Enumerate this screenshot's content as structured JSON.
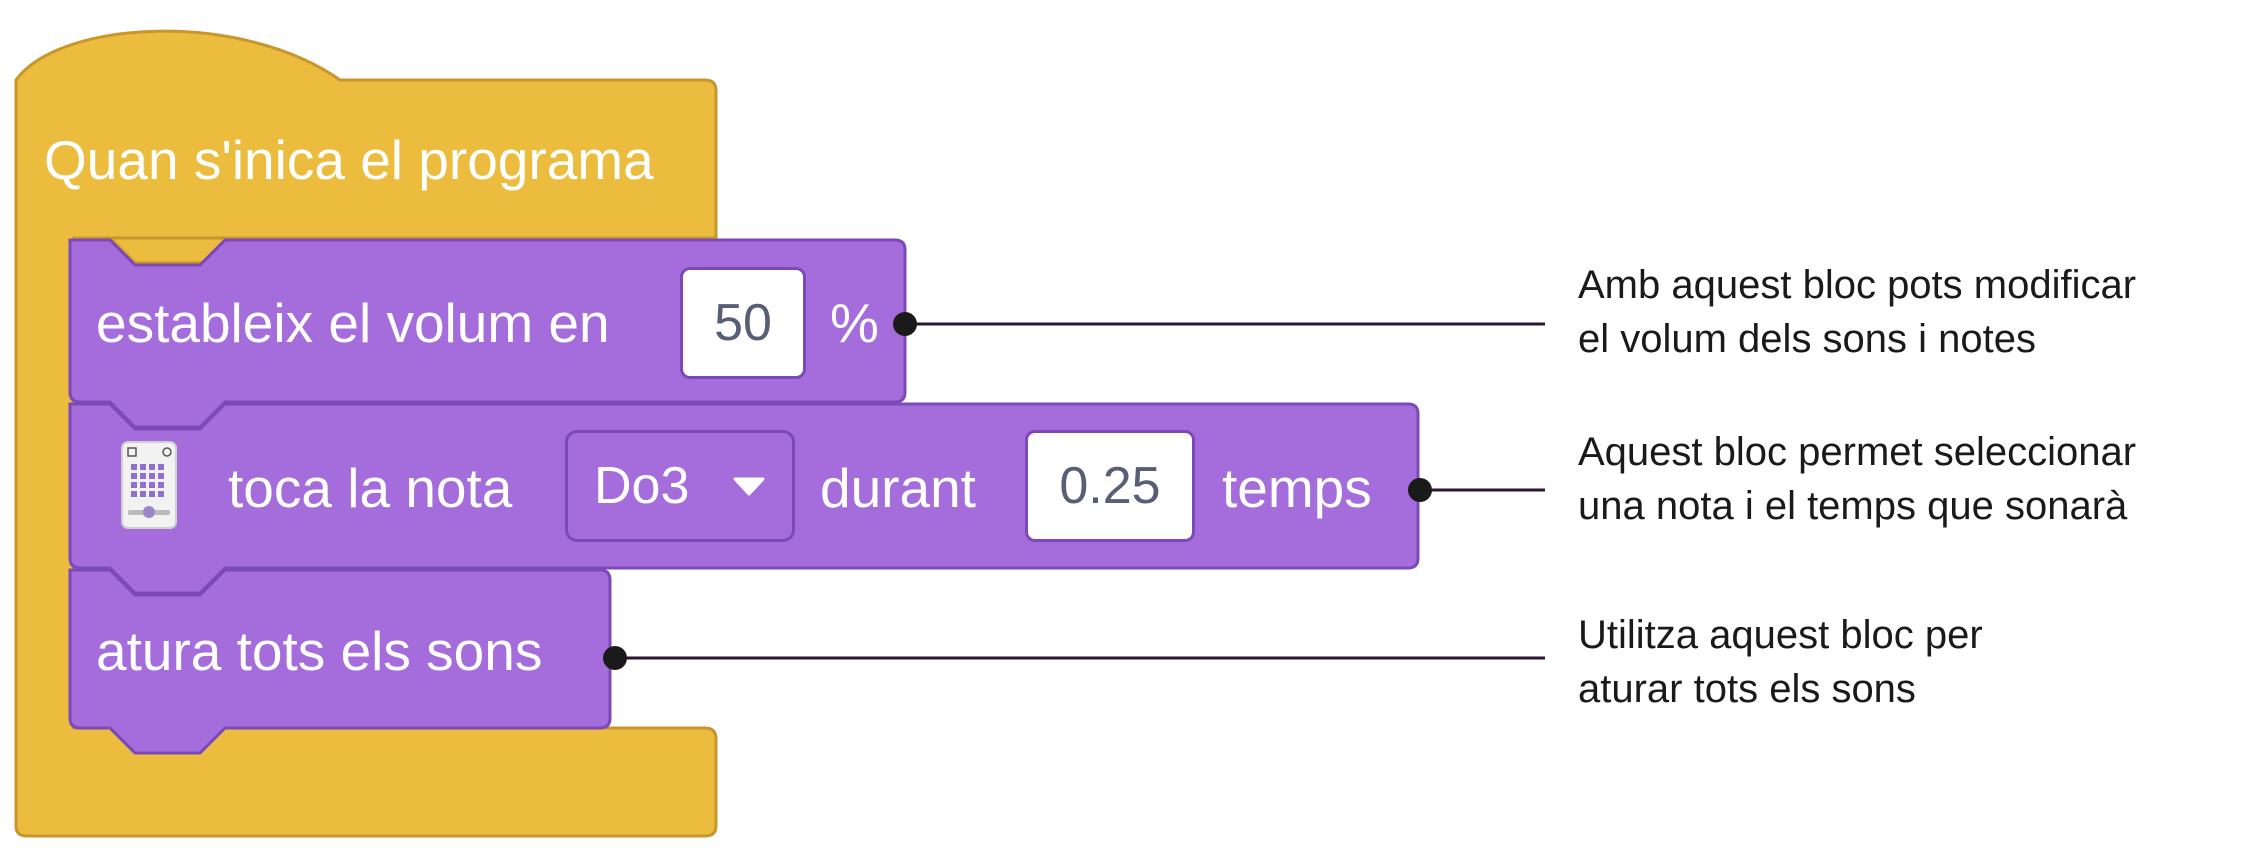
{
  "blocks": {
    "hat": {
      "label": "Quan s'inica el programa",
      "color": "#ecbc3f",
      "border": "#c9962b"
    },
    "set_volume": {
      "prefix": "estableix el volum en",
      "value": "50",
      "suffix": "%",
      "color": "#a56ddb",
      "border": "#7b4ab8"
    },
    "play_note": {
      "prefix": "toca la nota",
      "note": "Do3",
      "middle": "durant",
      "value": "0.25",
      "suffix": "temps",
      "icon": "microbit-board-icon"
    },
    "stop_sounds": {
      "label": "atura tots els sons"
    }
  },
  "annotations": [
    {
      "lines": [
        "Amb aquest bloc pots modificar",
        "el volum dels sons i notes"
      ]
    },
    {
      "lines": [
        "Aquest bloc permet seleccionar",
        "una nota i el temps que sonarà"
      ]
    },
    {
      "lines": [
        "Utilitza aquest bloc per",
        "aturar tots els sons"
      ]
    }
  ],
  "colors": {
    "leader_line": "#2b1533",
    "leader_dot": "#1a1a1a",
    "field_text": "#575e75"
  }
}
